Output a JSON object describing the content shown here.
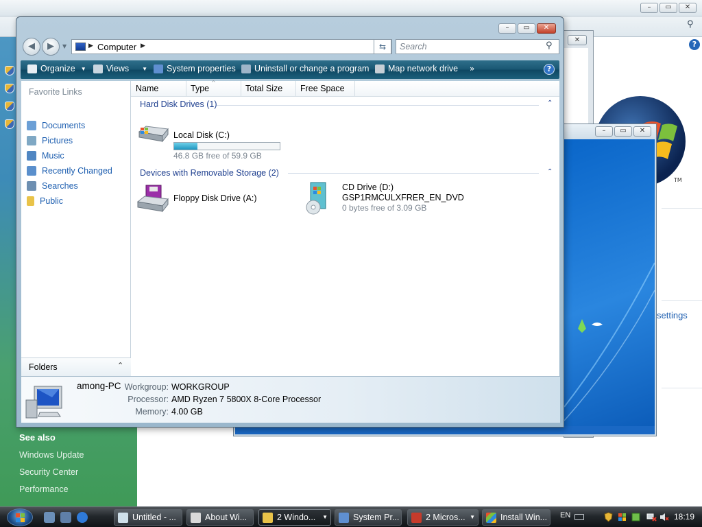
{
  "explorer": {
    "address": "Computer",
    "search_placeholder": "Search",
    "toolbar": {
      "organize": "Organize",
      "views": "Views",
      "system_properties": "System properties",
      "uninstall": "Uninstall or change a program",
      "map_drive": "Map network drive",
      "more": "»"
    },
    "favorite_links_title": "Favorite Links",
    "favorite_links": [
      "Documents",
      "Pictures",
      "Music",
      "Recently Changed",
      "Searches",
      "Public"
    ],
    "folders_label": "Folders",
    "columns": [
      "Name",
      "Type",
      "Total Size",
      "Free Space"
    ],
    "groups": {
      "hdd_title": "Hard Disk Drives (1)",
      "removable_title": "Devices with Removable Storage (2)"
    },
    "drives": {
      "local_disk": {
        "name": "Local Disk (C:)",
        "free_text": "46.8 GB free of 59.9 GB",
        "used_fraction": 0.22
      },
      "floppy": {
        "name": "Floppy Disk Drive (A:)"
      },
      "cd": {
        "name": "CD Drive (D:)",
        "label": "GSP1RMCULXFRER_EN_DVD",
        "free_text": "0 bytes free of 3.09 GB"
      }
    },
    "details": {
      "computer_name": "among-PC",
      "workgroup_label": "Workgroup:",
      "workgroup": "WORKGROUP",
      "processor_label": "Processor:",
      "processor": "AMD Ryzen 7 5800X 8-Core Processor",
      "memory_label": "Memory:",
      "memory": "4.00 GB"
    }
  },
  "background_window": {
    "see_also": "See also",
    "links": [
      "Windows Update",
      "Security Center",
      "Performance"
    ],
    "settings_link": "settings",
    "trademark": "TM"
  },
  "taskbar": {
    "buttons": [
      "Untitled - ...",
      "About Wi...",
      "2 Windo...",
      "System Pr...",
      "2 Micros...",
      "Install Win..."
    ],
    "language": "EN",
    "time": "18:19"
  },
  "colors": {
    "command_bar": "#195672",
    "link_blue": "#1e5fb0",
    "group_blue": "#1e3f8f",
    "drive_bar": "#1f95c0"
  }
}
